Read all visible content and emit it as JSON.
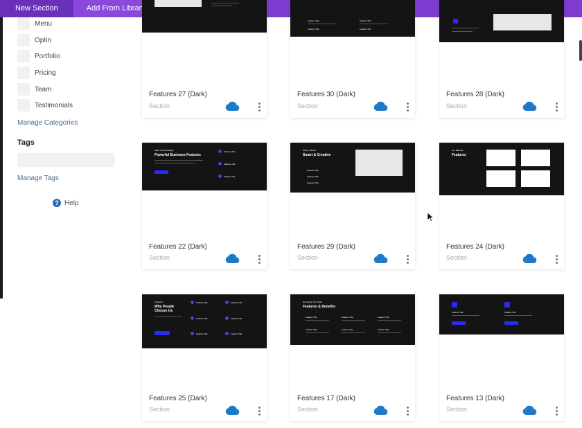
{
  "topbar": {
    "tabs": [
      {
        "label": "New Section"
      },
      {
        "label": "Add From Library"
      }
    ]
  },
  "sidebar": {
    "categories": [
      {
        "label": "Menu"
      },
      {
        "label": "Optin"
      },
      {
        "label": "Portfolio"
      },
      {
        "label": "Pricing"
      },
      {
        "label": "Team"
      },
      {
        "label": "Testimonials"
      }
    ],
    "manage_categories": "Manage Categories",
    "tags_heading": "Tags",
    "tags_input_value": "",
    "manage_tags": "Manage Tags",
    "help": "Help"
  },
  "cards": [
    {
      "title": "Features 27 (Dark)",
      "type": "Section"
    },
    {
      "title": "Features 30 (Dark)",
      "type": "Section"
    },
    {
      "title": "Features 28 (Dark)",
      "type": "Section"
    },
    {
      "title": "Features 22 (Dark)",
      "type": "Section"
    },
    {
      "title": "Features 29 (Dark)",
      "type": "Section"
    },
    {
      "title": "Features 24 (Dark)",
      "type": "Section"
    },
    {
      "title": "Features 25 (Dark)",
      "type": "Section"
    },
    {
      "title": "Features 17 (Dark)",
      "type": "Section"
    },
    {
      "title": "Features 13 (Dark)",
      "type": "Section"
    }
  ],
  "previews": {
    "p22": {
      "eyebrow": "Take The Advantage",
      "heading": "Powerful Business Features",
      "feature": "Feature Title"
    },
    "p29": {
      "eyebrow": "Stay In Motion",
      "heading": "Smart & Creative",
      "feature": "Feature Title"
    },
    "p24": {
      "eyebrow": "Our Benefits",
      "heading": "Features",
      "feature": "Feature Title"
    },
    "p25": {
      "eyebrow": "Features",
      "heading1": "Why People",
      "heading2": "Choose Us",
      "feature": "Feature Title"
    },
    "p17": {
      "eyebrow": "Everything You Need",
      "heading": "Features & Benefits",
      "feature": "Feature Title"
    },
    "p13": {
      "feature": "Feature Title"
    },
    "p30": {
      "feature": "Feature Title"
    }
  },
  "colors": {
    "brand": "#7e3bd0",
    "accent": "#6a2ee8",
    "cloud": "#1e7ac8",
    "thumb": "#141414"
  }
}
